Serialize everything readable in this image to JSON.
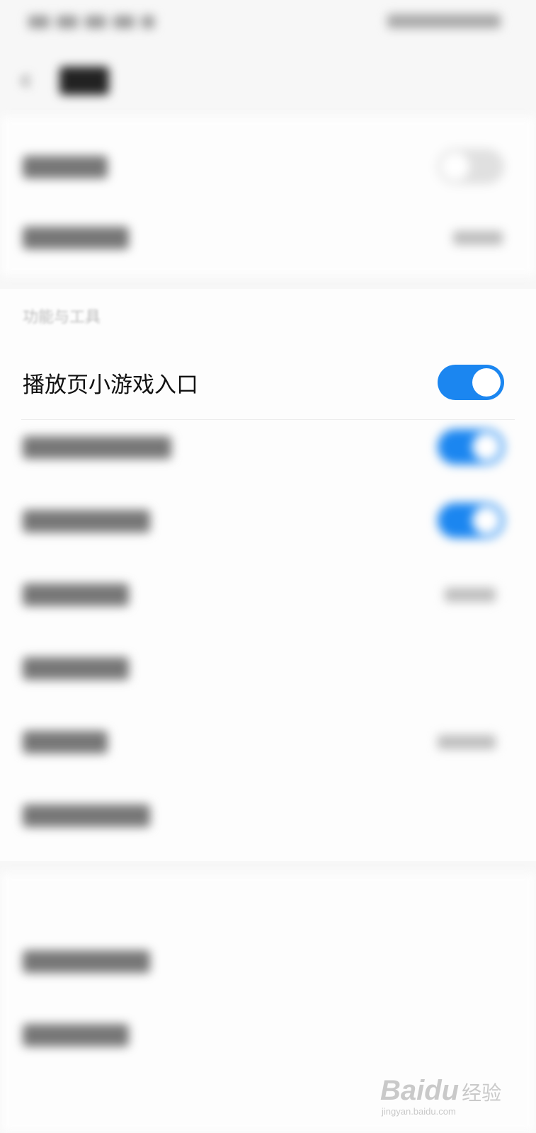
{
  "section": {
    "label": "功能与工具"
  },
  "focus_item": {
    "label": "播放页小游戏入口",
    "toggle_state": "on"
  },
  "colors": {
    "toggle_on": "#1b86f0",
    "toggle_off": "#e0e0e0",
    "background": "#f7f7f7"
  },
  "icons": {
    "back": "chevron-left-icon",
    "watermark": "baidu-logo-icon"
  },
  "watermark": {
    "mark": "Bai",
    "mark2": "du",
    "text": "经验",
    "url": "jingyan.baidu.com"
  }
}
